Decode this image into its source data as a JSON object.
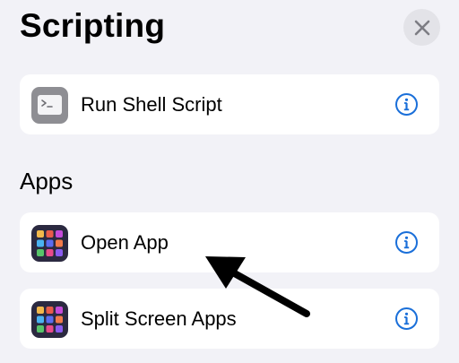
{
  "header": {
    "title": "Scripting",
    "close_icon": "close-icon"
  },
  "scripting_actions": [
    {
      "label": "Run Shell Script",
      "icon": "terminal-icon",
      "info_icon": "info-icon"
    }
  ],
  "apps_section": {
    "title": "Apps",
    "items": [
      {
        "label": "Open App",
        "icon": "app-grid-icon",
        "info_icon": "info-icon"
      },
      {
        "label": "Split Screen Apps",
        "icon": "app-grid-icon",
        "info_icon": "info-icon"
      }
    ]
  },
  "annotation": {
    "arrow_color": "#000000",
    "points_to": "Open App"
  },
  "colors": {
    "background": "#f2f2f7",
    "card": "#ffffff",
    "accent": "#1a6fd9",
    "close_button_bg": "#e3e3e8",
    "apps_icon_bg": "#2b2940",
    "shell_icon_bg": "#8e8e93"
  }
}
